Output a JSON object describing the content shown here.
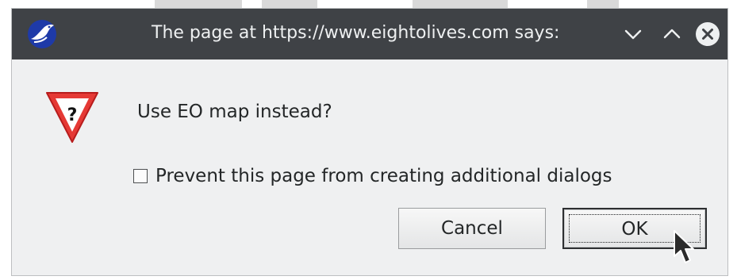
{
  "dialog": {
    "title": "The page at https://www.eightolives.com says:",
    "message": "Use EO map instead?",
    "prevent_checkbox": {
      "label": "Prevent this page from creating additional dialogs",
      "checked": false
    },
    "buttons": {
      "cancel": "Cancel",
      "ok": "OK"
    },
    "icons": {
      "app": "seamonkey-bird-icon",
      "warning": "question-warning-icon",
      "minimize": "chevron-down-icon",
      "maximize": "chevron-up-icon",
      "close": "close-icon"
    }
  },
  "colors": {
    "titlebar": "#3f4246",
    "title_text": "#eef0f1",
    "dialog_bg": "#eff0f1",
    "warning_red": "#e53935",
    "app_icon_blue": "#1e3aa8"
  }
}
